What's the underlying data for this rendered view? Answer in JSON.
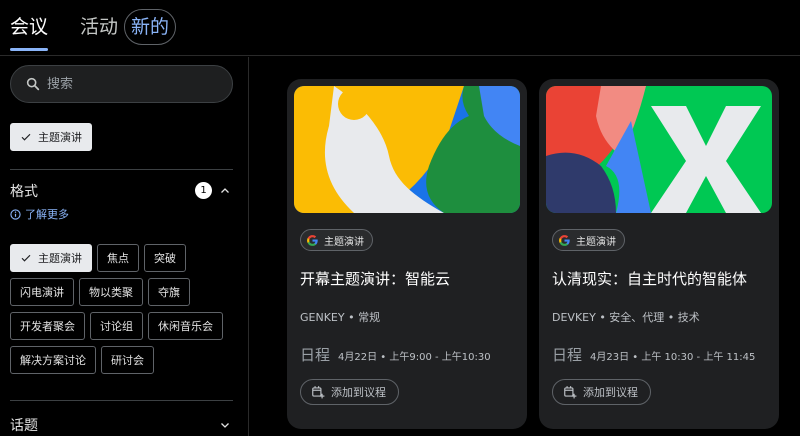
{
  "nav": {
    "tabs": [
      {
        "label": "会议"
      },
      {
        "label": "活动"
      },
      {
        "label": "新的"
      }
    ]
  },
  "sidebar": {
    "search_placeholder": "搜索",
    "selected_filter": "主题演讲",
    "format": {
      "title": "格式",
      "count": "1",
      "learn_more": "了解更多",
      "chips": [
        "主题演讲",
        "焦点",
        "突破",
        "闪电演讲",
        "物以类聚",
        "夺旗",
        "开发者聚会",
        "讨论组",
        "休闲音乐会",
        "解决方案讨论",
        "研讨会"
      ]
    },
    "topics": {
      "title": "话题"
    }
  },
  "cards": [
    {
      "tag": "主题演讲",
      "title": "开幕主题演讲：智能云",
      "meta": "GENKEY • 常规",
      "schedule_label": "日程",
      "schedule_text": "4月22日 • 上午9:00 - 上午10:30",
      "add_label": "添加到议程"
    },
    {
      "tag": "主题演讲",
      "title": "认清现实：自主时代的智能体",
      "meta": "DEVKEY • 安全、代理 • 技术",
      "schedule_label": "日程",
      "schedule_text": "4月23日 • 上午 10:30 - 上午 11:45",
      "add_label": "添加到议程"
    }
  ],
  "colors": {
    "accent": "#8ab4f8",
    "google_blue": "#4285f4",
    "google_red": "#ea4335",
    "google_yellow": "#fbbc04",
    "google_green": "#34a853"
  }
}
